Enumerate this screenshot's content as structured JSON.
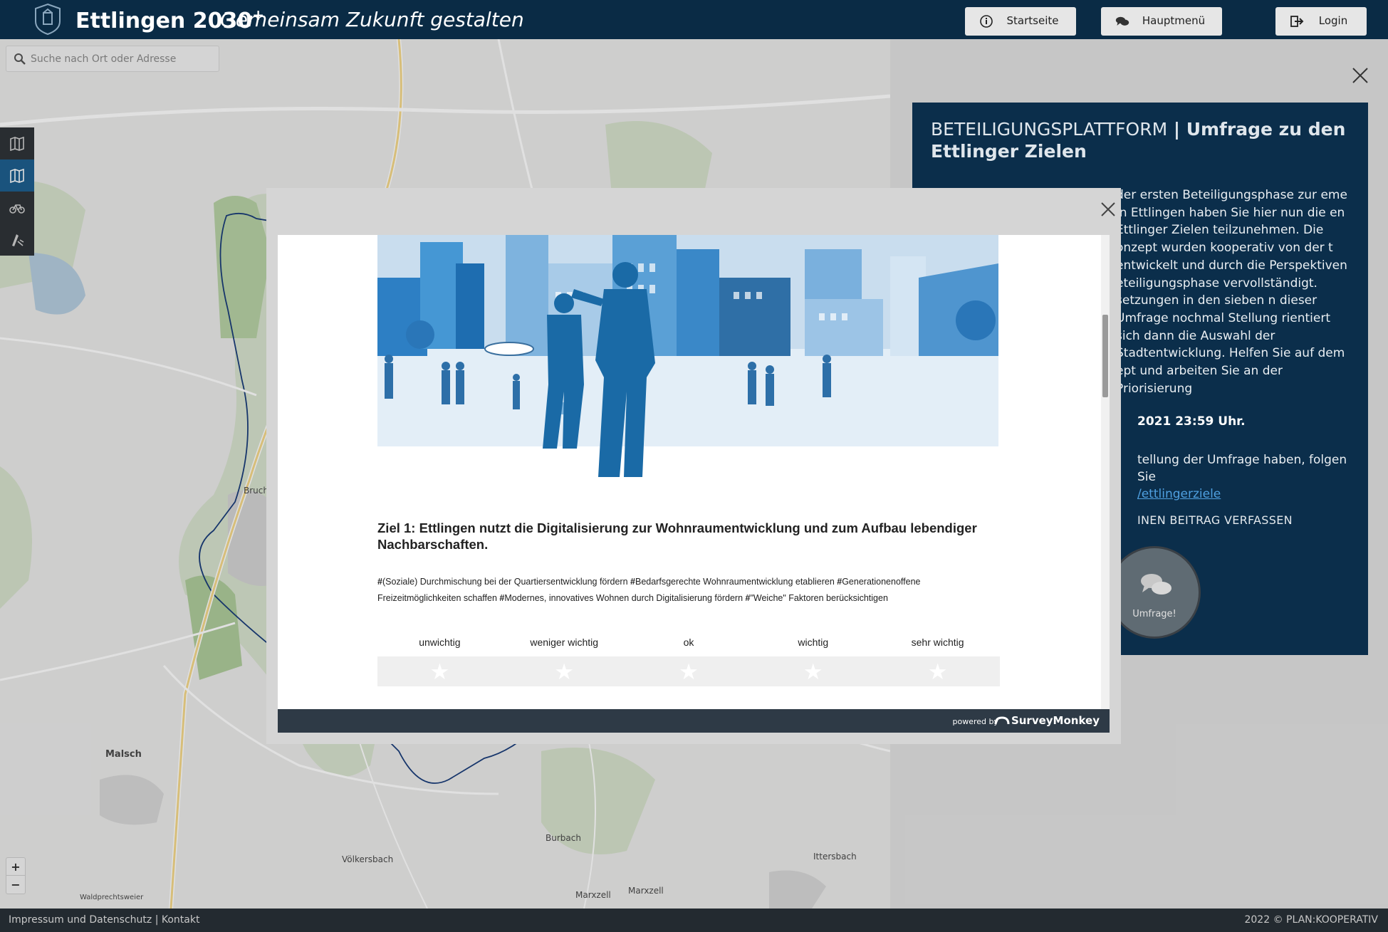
{
  "header": {
    "title": "Ettlingen 2030",
    "title_sup": "+",
    "tagline": "Gemeinsam Zukunft gestalten",
    "buttons": {
      "start": "Startseite",
      "menu": "Hauptmenü",
      "login": "Login"
    }
  },
  "search": {
    "placeholder": "Suche nach Ort oder Adresse"
  },
  "map": {
    "labels": [
      "Malsch",
      "Bruch",
      "Ittersbach",
      "Marxzell",
      "Marxzell",
      "Burbach",
      "Völkersbach",
      "Waldprechtsweier"
    ],
    "zoom": {
      "in": "+",
      "out": "−"
    }
  },
  "panel": {
    "title_pre": "BETEILIGUNGSPLATTFORM",
    "title_sep": " | ",
    "title_main": "Umfrage zu den Ettlinger Zielen",
    "text": "der ersten Beteiligungsphase zur eme in Ettlingen haben Sie hier nun die en Ettlinger Zielen teilzunehmen. Die onzept wurden kooperativ von der t entwickelt und durch die Perspektiven eteiligungsphase vervollständigt. setzungen in den sieben n dieser Umfrage nochmal Stellung rientiert sich dann die Auswahl der Stadtentwicklung. Helfen Sie auf dem ept und arbeiten Sie an der Priorisierung",
    "deadline": "2021 23:59 Uhr.",
    "link_text": "tellung der Umfrage haben, folgen Sie",
    "link": "/ettlingerziele",
    "cta": "INEN BEITRAG VERFASSEN",
    "bubble_label": "Umfrage!"
  },
  "modal": {
    "question": "Ziel 1: Ettlingen nutzt die Digitalisierung zur Wohnraumentwicklung und zum Aufbau lebendiger Nachbarschaften.",
    "tags": [
      {
        "hash": "#",
        "text": "(Soziale) Durchmischung bei der Quartiersentwicklung fördern "
      },
      {
        "hash": "#",
        "text": "Bedarfsgerechte Wohnraumentwicklung etablieren "
      },
      {
        "hash": "#",
        "text": "Generationenoffene Freizeitmöglichkeiten schaffen "
      },
      {
        "hash": "#",
        "text": "Modernes, innovatives Wohnen durch Digitalisierung fördern "
      },
      {
        "hash": "#",
        "text": "\"Weiche\" Faktoren berücksichtigen"
      }
    ],
    "scale": [
      "unwichtig",
      "weniger wichtig",
      "ok",
      "wichtig",
      "sehr wichtig"
    ],
    "rating_value": 0,
    "rating_max": 5,
    "star_glyph": "★",
    "powered_by": "powered by",
    "brand": "SurveyMonkey"
  },
  "footer": {
    "left": "Impressum und Datenschutz | Kontakt",
    "right": "2022 © PLAN:KOOPERATIV"
  },
  "colors": {
    "header_bg": "#0a2b45",
    "panel_bg": "#0b2e4b",
    "link": "#4fa0e0",
    "footer_bg": "#232a30",
    "active_layer": "#1e5f8f"
  }
}
